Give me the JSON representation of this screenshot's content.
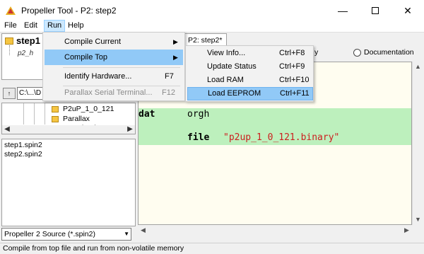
{
  "window": {
    "title": "Propeller Tool - P2: step2",
    "icons": {
      "app": "propeller-app-icon",
      "minimize": "minimize-icon",
      "maximize": "maximize-icon",
      "close": "close-icon"
    }
  },
  "menubar": {
    "file": "File",
    "edit": "Edit",
    "run": "Run",
    "help": "Help"
  },
  "run_menu": {
    "items": [
      {
        "label": "Compile Current",
        "shortcut": "",
        "submenu": true,
        "enabled": true
      },
      {
        "label": "Compile Top",
        "shortcut": "",
        "submenu": true,
        "enabled": true,
        "highlighted": true
      },
      {
        "label": "Identify Hardware...",
        "shortcut": "F7",
        "submenu": false,
        "enabled": true
      },
      {
        "label": "Parallax Serial Terminal...",
        "shortcut": "F12",
        "submenu": false,
        "enabled": false
      }
    ]
  },
  "compile_top_submenu": {
    "items": [
      {
        "label": "View Info...",
        "shortcut": "Ctrl+F8"
      },
      {
        "label": "Update Status",
        "shortcut": "Ctrl+F9"
      },
      {
        "label": "Load RAM",
        "shortcut": "Ctrl+F10"
      },
      {
        "label": "Load EEPROM",
        "shortcut": "Ctrl+F11",
        "highlighted": true
      }
    ]
  },
  "left_panel": {
    "tree_root": "step1",
    "tree_child": "p2_h",
    "path_combo": "C:\\...\\D",
    "drive_icon_text": "↑",
    "folders": [
      "P2uP_1_0_121",
      "Parallax Downloads"
    ],
    "files": [
      "step1.spin2",
      "step2.spin2"
    ],
    "filter": "Propeller 2 Source (*.spin2)"
  },
  "editor": {
    "tab_label": "P2: step2*",
    "radio_partial": "y",
    "radio_documentation": "Documentation",
    "code": {
      "keyword_dat": "dat",
      "directive_orgh": "orgh",
      "keyword_file": "file",
      "string_value": "\"p2up_1_0_121.binary\""
    }
  },
  "status_bar": {
    "text": "Compile from top file and run from non-volatile memory"
  },
  "colors": {
    "menu_highlight": "#91c9f7",
    "menubar_active": "#cce8ff",
    "editor_bg": "#fffdf0",
    "dat_block": "#bdf0bd",
    "string_color": "#cc2020"
  }
}
